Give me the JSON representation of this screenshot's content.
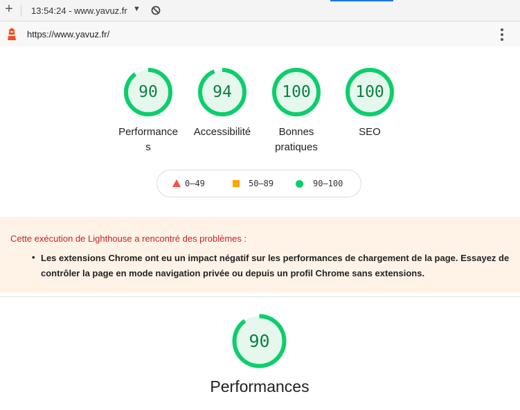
{
  "browser": {
    "tab_title": "13:54:24 - www.yavuz.fr",
    "new_tab_glyph": "+",
    "dropdown_glyph": "▼",
    "url": "https://www.yavuz.fr/",
    "accent_color": "#1a73e8"
  },
  "scores": [
    {
      "label": "Performance\ns",
      "value": "90",
      "fraction": 0.9
    },
    {
      "label": "Accessibilité",
      "value": "94",
      "fraction": 0.94
    },
    {
      "label": "Bonnes\npratiques",
      "value": "100",
      "fraction": 1.0
    },
    {
      "label": "SEO",
      "value": "100",
      "fraction": 1.0
    }
  ],
  "legend": {
    "fail": "0–49",
    "average": "50–89",
    "pass": "90–100",
    "colors": {
      "fail": "#ff4e42",
      "average": "#ffa400",
      "pass": "#0cce6b"
    }
  },
  "warning": {
    "title": "Cette exécution de Lighthouse a rencontré des problèmes :",
    "items": [
      "Les extensions Chrome ont eu un impact négatif sur les performances de chargement de la page. Essayez de contrôler la page en mode navigation privée ou depuis un profil Chrome sans extensions."
    ],
    "background": "#fff3e8",
    "title_color": "#c5221f"
  },
  "performance_section": {
    "title": "Performances",
    "value": "90",
    "fraction": 0.9
  },
  "icons": {
    "new_tab": "plus-icon",
    "dropdown": "caret-down-icon",
    "blocked": "block-icon",
    "logo": "lighthouse-icon",
    "menu": "kebab-menu-icon"
  },
  "gauge_colors": {
    "ring": "#0cce6b",
    "fill": "#e6f8ee",
    "text": "#0b8043"
  }
}
